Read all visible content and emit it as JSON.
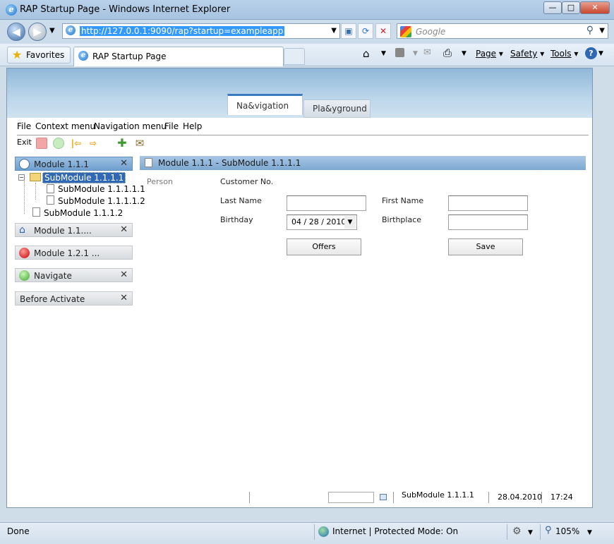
{
  "window": {
    "title": "RAP Startup Page - Windows Internet Explorer"
  },
  "window_buttons": {
    "minimize": "—",
    "maximize": "□",
    "close": "✕"
  },
  "addressbar": {
    "url": "http://127.0.0.1:9090/rap?startup=exampleapp",
    "search_placeholder": "Google"
  },
  "favorites": {
    "label": "Favorites"
  },
  "browser_tab": {
    "title": "RAP Startup Page"
  },
  "commandbar": {
    "page": "Page",
    "safety": "Safety",
    "tools": "Tools"
  },
  "app": {
    "tabs": [
      "Na&vigation",
      "Pla&yground"
    ],
    "menu": [
      "File",
      "Context menu",
      "Navigation menu",
      "File",
      "Help"
    ],
    "toolbar": {
      "exit": "Exit"
    },
    "nav": {
      "groups": [
        {
          "label": "Module 1.1.1",
          "icon": "module-icon"
        },
        {
          "label": "Module 1.1....",
          "icon": "home-icon"
        },
        {
          "label": "Module 1.2.1 ...",
          "icon": "red-circle-icon"
        },
        {
          "label": "Navigate",
          "icon": "green-circle-icon"
        },
        {
          "label": "Before Activate",
          "icon": ""
        }
      ],
      "tree": [
        "SubModule 1.1.1.1",
        "SubModule 1.1.1.1.1",
        "SubModule 1.1.1.1.2",
        "SubModule 1.1.1.2"
      ]
    },
    "module": {
      "title": "Module 1.1.1 - SubModule 1.1.1.1",
      "section": "Person",
      "labels": {
        "customer_no": "Customer No.",
        "last_name": "Last Name",
        "first_name": "First Name",
        "birthday": "Birthday",
        "birthplace": "Birthplace"
      },
      "birthday_value": "04 / 28 / 2010",
      "buttons": {
        "offers": "Offers",
        "save": "Save"
      }
    },
    "statusbar": {
      "submodule": "SubModule 1.1.1.1",
      "date": "28.04.2010",
      "time": "17:24"
    }
  },
  "iestatus": {
    "left": "Done",
    "zone": "Internet | Protected Mode: On",
    "zoom": "105%"
  }
}
